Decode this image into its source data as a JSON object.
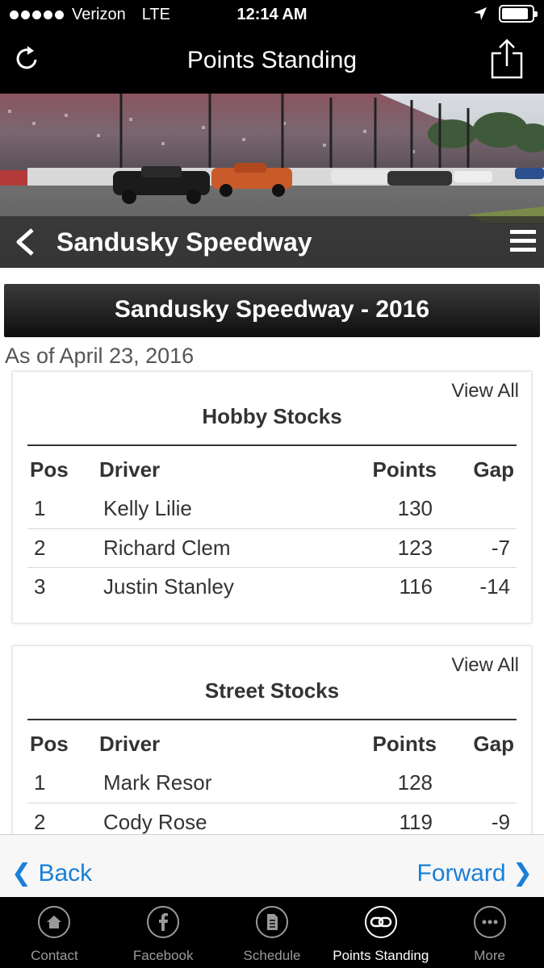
{
  "status_bar": {
    "carrier": "Verizon",
    "network": "LTE",
    "time": "12:14 AM",
    "battery_level": 0.9
  },
  "nav_bar": {
    "title": "Points Standing"
  },
  "hero": {
    "title": "Sandusky Speedway"
  },
  "content": {
    "season_header": "Sandusky Speedway - 2016",
    "as_of": "As of April 23, 2016",
    "cards": [
      {
        "view_all": "View All",
        "title": "Hobby Stocks",
        "columns": [
          "Pos",
          "Driver",
          "Points",
          "Gap"
        ],
        "rows": [
          {
            "pos": "1",
            "driver": "Kelly Lilie",
            "points": "130",
            "gap": ""
          },
          {
            "pos": "2",
            "driver": "Richard Clem",
            "points": "123",
            "gap": "-7"
          },
          {
            "pos": "3",
            "driver": "Justin Stanley",
            "points": "116",
            "gap": "-14"
          }
        ]
      },
      {
        "view_all": "View All",
        "title": "Street Stocks",
        "columns": [
          "Pos",
          "Driver",
          "Points",
          "Gap"
        ],
        "rows": [
          {
            "pos": "1",
            "driver": "Mark Resor",
            "points": "128",
            "gap": ""
          },
          {
            "pos": "2",
            "driver": "Cody Rose",
            "points": "119",
            "gap": "-9"
          }
        ]
      }
    ]
  },
  "web_nav": {
    "back": "❮ Back",
    "forward": "Forward ❯"
  },
  "tab_bar": {
    "items": [
      {
        "label": "Contact",
        "icon": "home-icon"
      },
      {
        "label": "Facebook",
        "icon": "facebook-icon"
      },
      {
        "label": "Schedule",
        "icon": "document-icon"
      },
      {
        "label": "Points Standing",
        "icon": "link-icon"
      },
      {
        "label": "More",
        "icon": "more-icon"
      }
    ],
    "active_index": 3
  },
  "colors": {
    "link_blue": "#1a7fd8",
    "bar_black": "#000000",
    "inactive_tab": "#9a9a9a"
  }
}
